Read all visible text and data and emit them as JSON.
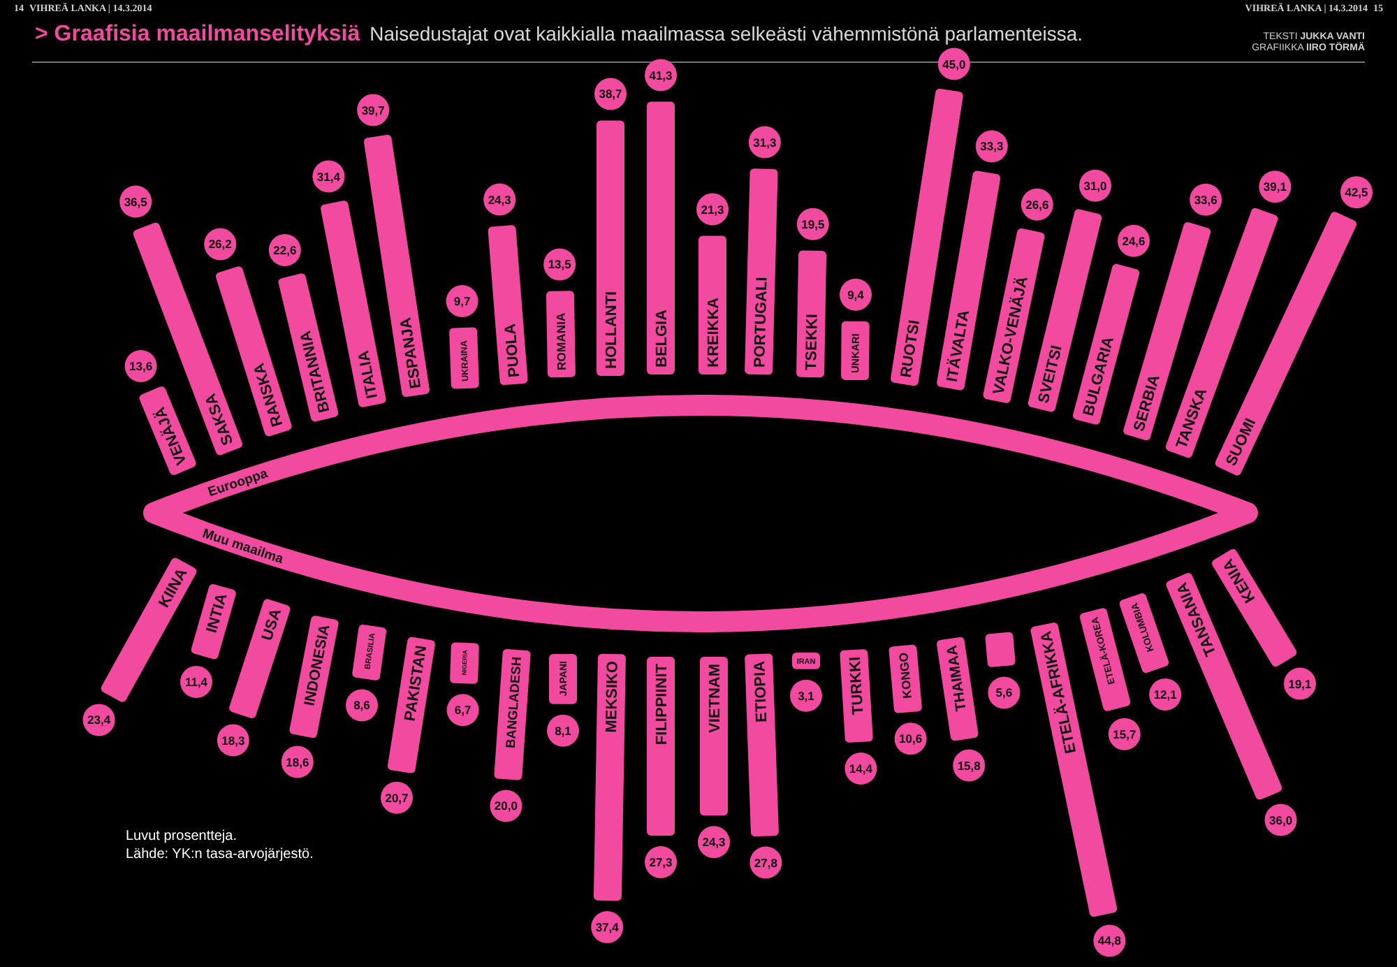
{
  "header": {
    "left": {
      "page": "14",
      "masthead": "VIHREÄ LANKA | 14.3.2014"
    },
    "right": {
      "masthead": "VIHREÄ LANKA | 14.3.2014",
      "page": "15"
    }
  },
  "title": "> Graafisia maailmanselityksiä",
  "subtitle": "Naisedustajat ovat kaikkialla maailmassa selkeästi vähemmistönä parlamenteissa.",
  "credits": [
    "TEKSTI **JUKKA VANTI**",
    "GRAFIIKKA **IIRO TÖRMÄ**"
  ],
  "regions": [
    {
      "label": "Eurooppa",
      "countries": [
        {
          "name": "VENÄJÄ",
          "value": "13,6"
        },
        {
          "name": "SAKSA",
          "value": "36,5"
        },
        {
          "name": "RANSKA",
          "value": "26,2"
        },
        {
          "name": "BRITANNIA",
          "value": "22,6"
        },
        {
          "name": "ITALIA",
          "value": "31,4"
        },
        {
          "name": "ESPANJA",
          "value": "39,7"
        },
        {
          "name": "UKRAINA",
          "value": "9,7"
        },
        {
          "name": "PUOLA",
          "value": "24,3"
        },
        {
          "name": "ROMANIA",
          "value": "13,5"
        },
        {
          "name": "HOLLANTI",
          "value": "38,7"
        },
        {
          "name": "BELGIA",
          "value": "41,3"
        },
        {
          "name": "KREIKKA",
          "value": "21,3"
        },
        {
          "name": "PORTUGALI",
          "value": "31,3"
        },
        {
          "name": "TSEKKI",
          "value": "19,5"
        },
        {
          "name": "UNKARI",
          "value": "9,4"
        },
        {
          "name": "RUOTSI",
          "value": "45,0"
        },
        {
          "name": "ITÄVALTA",
          "value": "33,3"
        },
        {
          "name": "VALKO-VENÄJÄ",
          "value": "26,6"
        },
        {
          "name": "SVEITSI",
          "value": "31,0"
        },
        {
          "name": "BULGARIA",
          "value": "24,6"
        },
        {
          "name": "SERBIA",
          "value": "33,6"
        },
        {
          "name": "TANSKA",
          "value": "39,1"
        },
        {
          "name": "SUOMI",
          "value": "42,5"
        }
      ]
    },
    {
      "label": "Muu maailma",
      "countries": [
        {
          "name": "KIINA",
          "value": "23,4"
        },
        {
          "name": "INTIA",
          "value": "11,4"
        },
        {
          "name": "USA",
          "value": "18,3"
        },
        {
          "name": "INDONESIA",
          "value": "18,6"
        },
        {
          "name": "BRASILIA",
          "value": "8,6"
        },
        {
          "name": "PAKISTAN",
          "value": "20,7"
        },
        {
          "name": "NIGERIA",
          "value": "6,7"
        },
        {
          "name": "BANGLADESH",
          "value": "20,0"
        },
        {
          "name": "JAPANI",
          "value": "8,1"
        },
        {
          "name": "MEKSIKO",
          "value": "37,4"
        },
        {
          "name": "FILIPPIINIT",
          "value": "27,3"
        },
        {
          "name": "VIETNAM",
          "value": "24,3"
        },
        {
          "name": "ETIOPIA",
          "value": "27,8"
        },
        {
          "name": "IRAN",
          "value": "3,1"
        },
        {
          "name": "TURKKI",
          "value": "14,4"
        },
        {
          "name": "KONGO",
          "value": "10,6"
        },
        {
          "name": "THAIMAA",
          "value": "15,8"
        },
        {
          "value": "5,6"
        },
        {
          "name": "ETELÄ-AFRIKKA",
          "value": "44,8"
        },
        {
          "name": "ETELÄ-KOREA",
          "value": "15,7"
        },
        {
          "name": "KOLUMBIA",
          "value": "12,1"
        },
        {
          "name": "TANSANIA",
          "value": "36,0"
        },
        {
          "name": "KENIA",
          "value": "19,1"
        }
      ]
    }
  ],
  "notes": [
    "Luvut prosentteja.",
    "Lähde: YK:n tasa-arvojärjestö."
  ]
}
